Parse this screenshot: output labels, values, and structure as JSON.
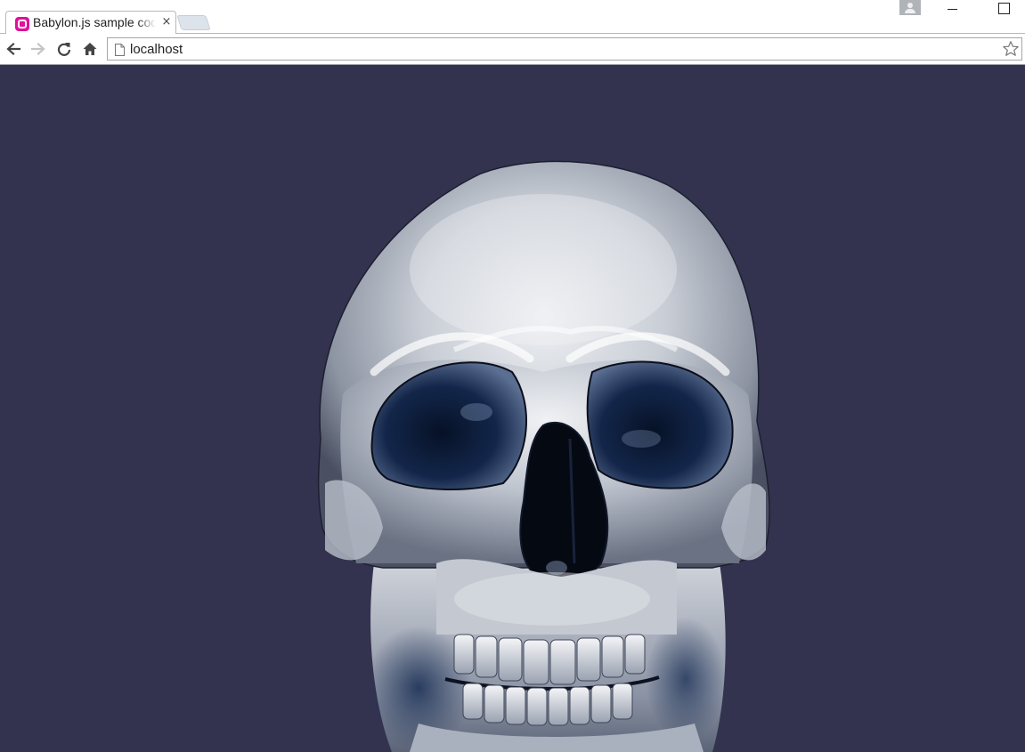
{
  "browser": {
    "tab": {
      "title": "Babylon.js sample code",
      "close_glyph": "×",
      "favicon": "babylon-favicon"
    },
    "new_tab": "new-tab-button",
    "window_controls": [
      "minimize-icon",
      "maximize-icon"
    ],
    "profile": "profile-icon"
  },
  "toolbar": {
    "icons": [
      "back-arrow-icon",
      "forward-arrow-icon",
      "reload-icon",
      "home-icon"
    ],
    "address": {
      "value": "localhost",
      "icon": "page-icon"
    },
    "bookmark": "star-icon"
  },
  "scene": {
    "background_color": "#34334f",
    "subject": "skull-model",
    "colors": {
      "bone_light": "#e8eaee",
      "bone_mid": "#a9b0bc",
      "shadow": "#0b0f1c",
      "blue_shadow": "#22365c"
    }
  }
}
